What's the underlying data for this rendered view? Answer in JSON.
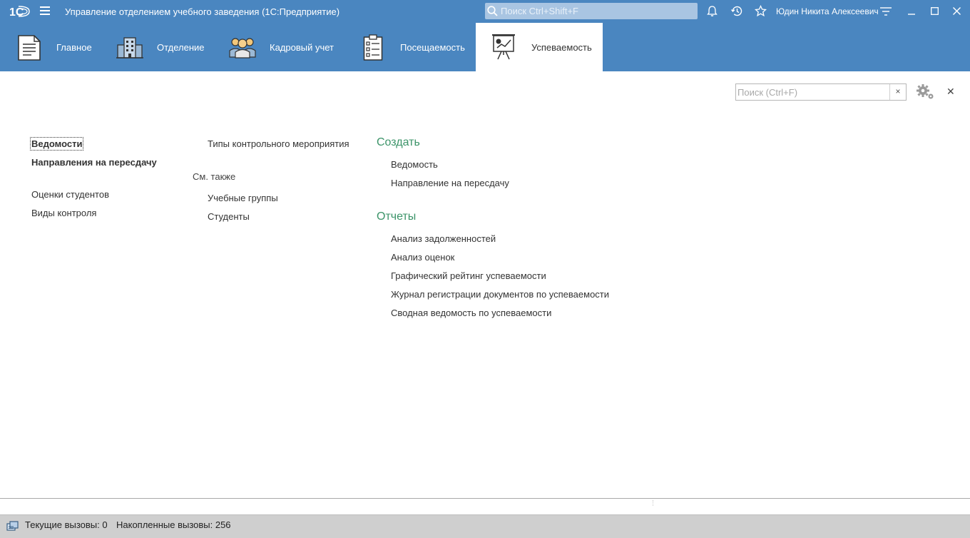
{
  "titlebar": {
    "app_title": "Управление отделением учебного заведения  (1С:Предприятие)",
    "search_placeholder": "Поиск Ctrl+Shift+F",
    "user_name": "Юдин Никита Алексеевич",
    "accent_color": "#4a86c0"
  },
  "sections": [
    {
      "label": "Главное",
      "icon": "document-icon",
      "active": false
    },
    {
      "label": "Отделение",
      "icon": "building-icon",
      "active": false
    },
    {
      "label": "Кадровый учет",
      "icon": "people-icon",
      "active": false
    },
    {
      "label": "Посещаемость",
      "icon": "checklist-icon",
      "active": false
    },
    {
      "label": "Успеваемость",
      "icon": "presentation-board-icon",
      "active": true
    }
  ],
  "form": {
    "search_placeholder": "Поиск (Ctrl+F)",
    "clear_label": "×",
    "close_label": "✕"
  },
  "navigation": {
    "column1": [
      "Ведомости",
      "Направления на пересдачу",
      "Оценки студентов",
      "Виды контроля"
    ],
    "column2_top": [
      "Типы контрольного мероприятия"
    ],
    "see_also_title": "См. также",
    "see_also": [
      "Учебные группы",
      "Студенты"
    ]
  },
  "actions": {
    "create_title": "Создать",
    "create": [
      "Ведомость",
      "Направление на пересдачу"
    ],
    "reports_title": "Отчеты",
    "reports": [
      "Анализ задолженностей",
      "Анализ оценок",
      "Графический рейтинг успеваемости",
      "Журнал регистрации документов по успеваемости",
      "Сводная ведомость по успеваемости"
    ],
    "group_title_color": "#3c9469"
  },
  "statusbar": {
    "current_calls": "Текущие вызовы: 0",
    "accumulated_calls": "Накопленные вызовы: 256"
  }
}
